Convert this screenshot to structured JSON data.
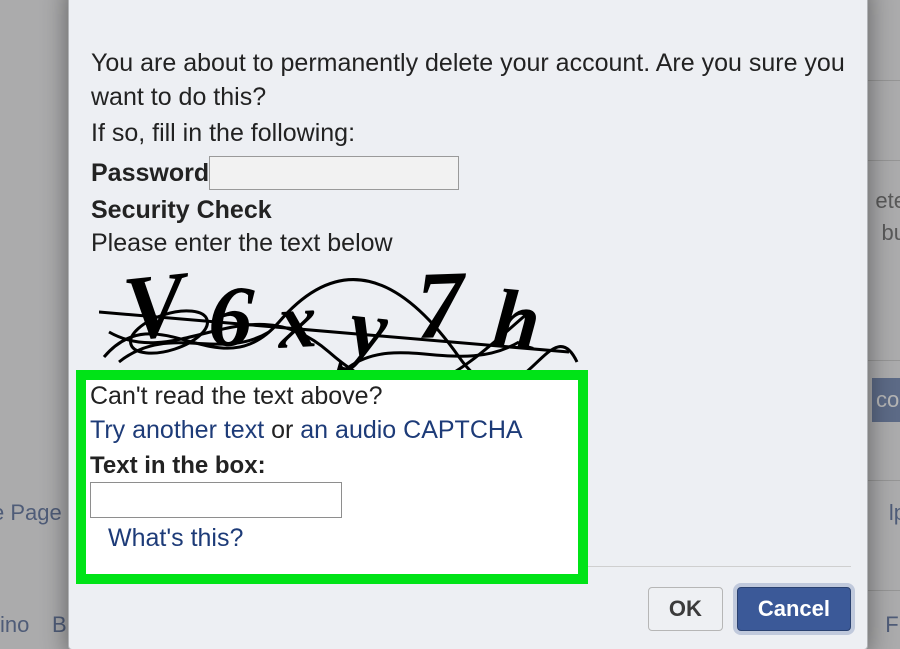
{
  "background": {
    "link_page": "e Page",
    "link_ino": "ino",
    "frag_b": "B",
    "frag_ete": "ete",
    "frag_pu": "bu",
    "frag_co": "co",
    "frag_lp": "lp",
    "frag_fr": "Fr"
  },
  "modal": {
    "warning": "You are about to permanently delete your account. Are you sure you want to do this?",
    "instruction": "If so, fill in the following:",
    "password_label": "Password",
    "password_value": "",
    "security_heading": "Security Check",
    "enter_text_prompt": "Please enter the text below",
    "captcha_text": "V6xy7h",
    "buttons": {
      "ok": "OK",
      "cancel": "Cancel"
    }
  },
  "highlight": {
    "cant_read": "Can't read the text above?",
    "try_another": "Try another text",
    "or": " or ",
    "audio": "an audio CAPTCHA",
    "text_in_box_label": "Text in the box:",
    "captcha_input_value": "",
    "whats_this": "What's this?"
  }
}
